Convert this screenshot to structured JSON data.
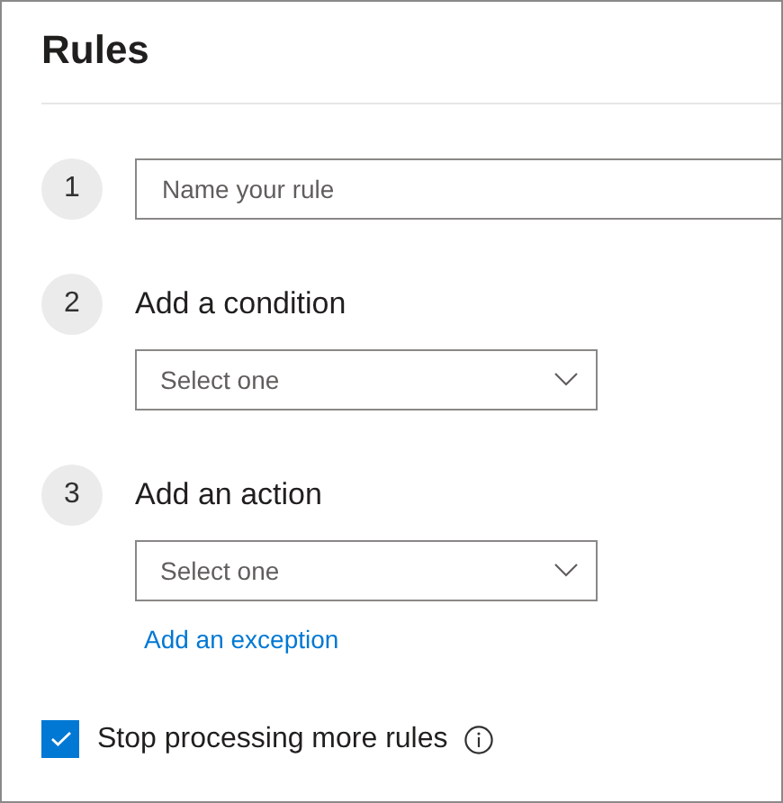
{
  "title": "Rules",
  "steps": [
    {
      "number": "1",
      "kind": "input",
      "placeholder": "Name your rule"
    },
    {
      "number": "2",
      "kind": "select",
      "label": "Add a condition",
      "placeholder": "Select one"
    },
    {
      "number": "3",
      "kind": "select",
      "label": "Add an action",
      "placeholder": "Select one",
      "link": "Add an exception"
    }
  ],
  "stop_processing": {
    "label": "Stop processing more rules",
    "checked": true
  }
}
